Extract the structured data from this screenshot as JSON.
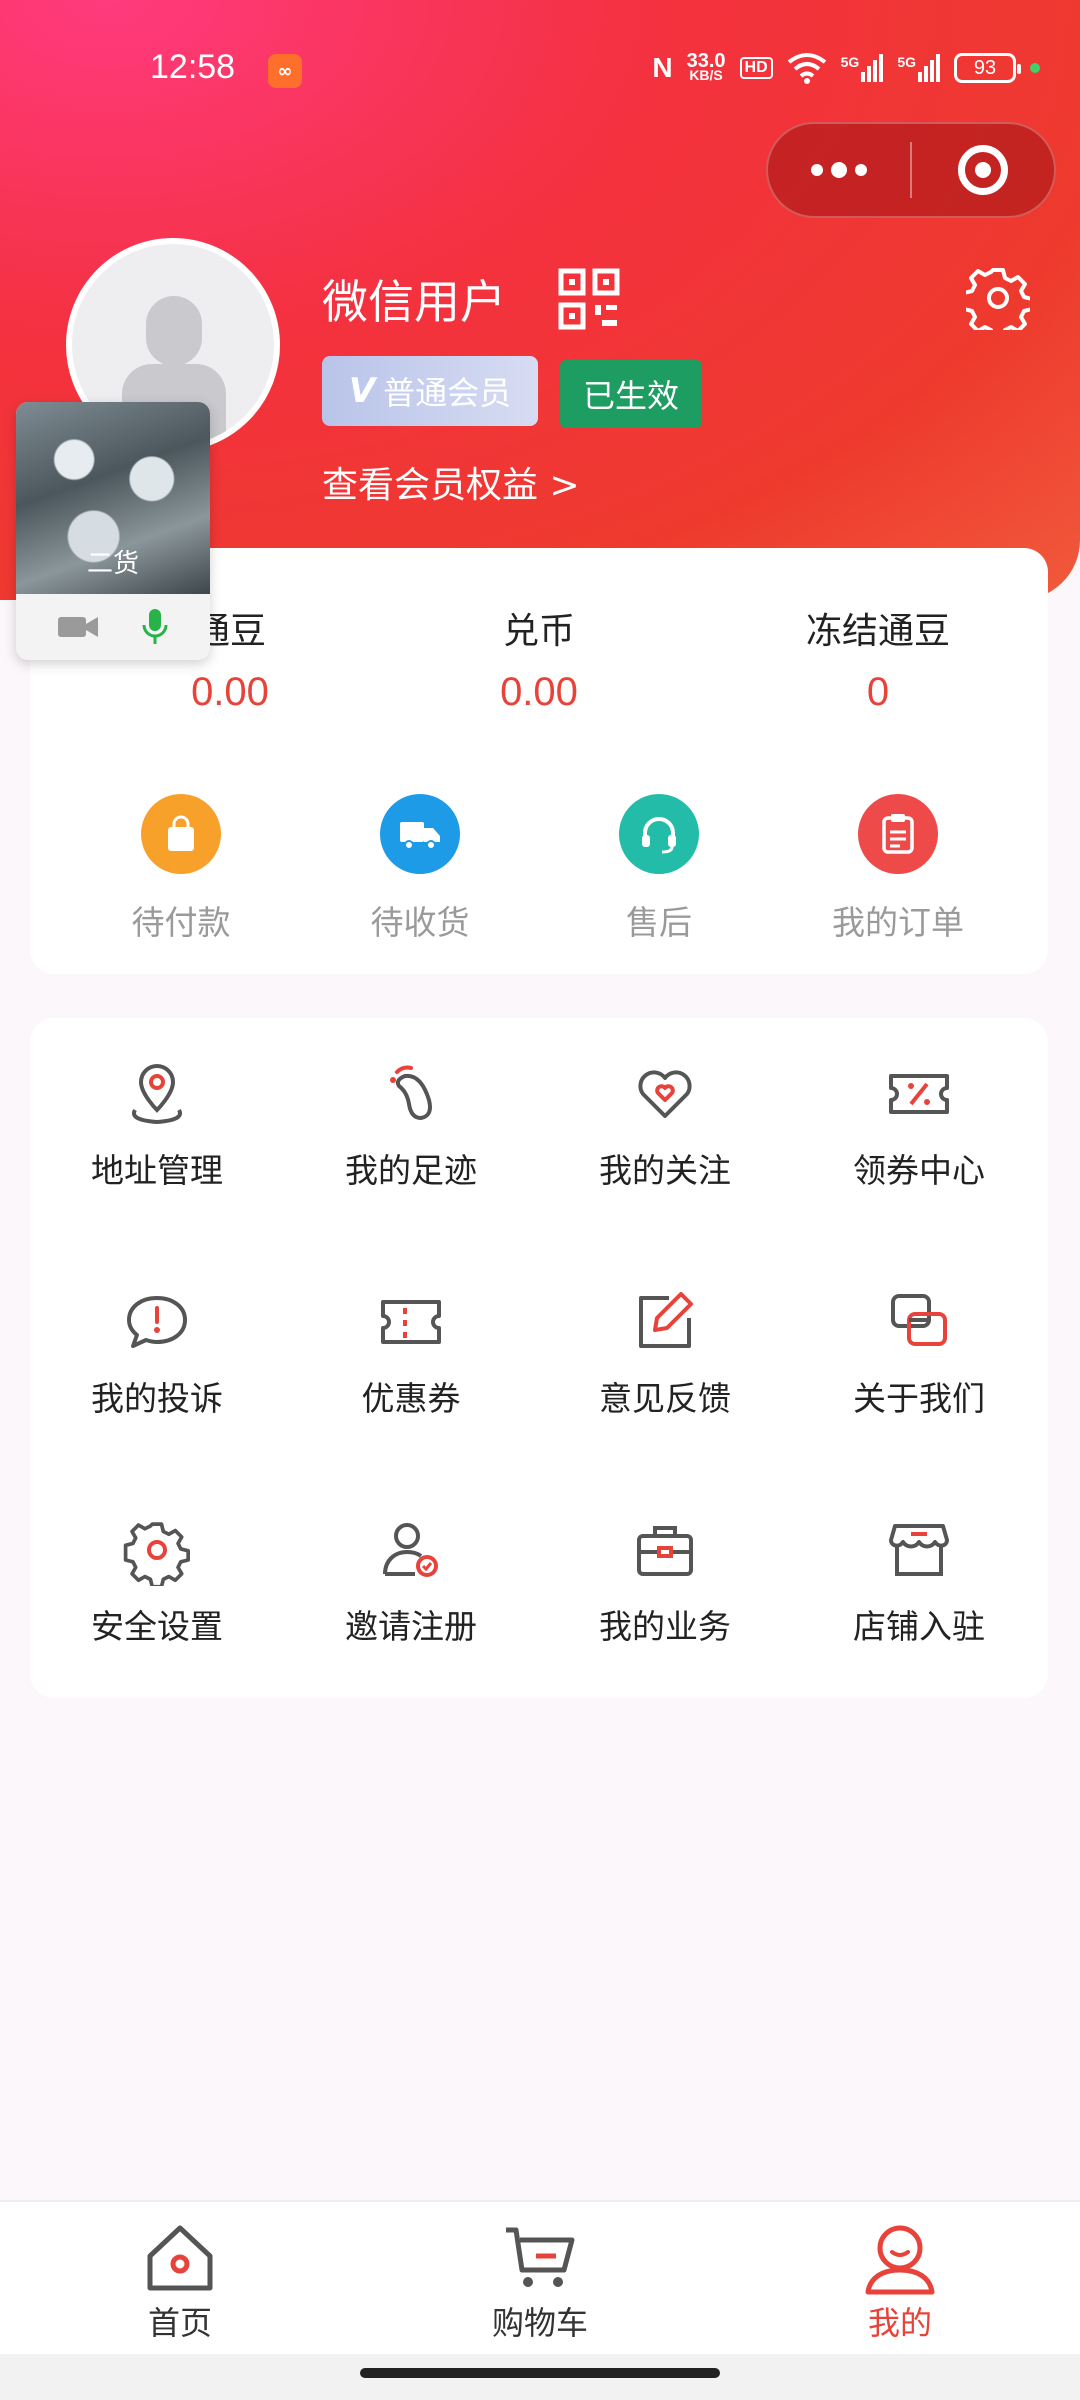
{
  "status_bar": {
    "time": "12:58",
    "speed_value": "33.0",
    "speed_unit": "KB/S",
    "hd": "HD",
    "net1": "5G",
    "net2": "5G",
    "battery": "93"
  },
  "profile": {
    "username": "微信用户",
    "vip_letter": "V",
    "vip_label": "普通会员",
    "status_badge": "已生效",
    "member_link": "查看会员权益 >"
  },
  "float_video": {
    "name": "二货"
  },
  "assets": [
    {
      "label": "通豆",
      "value": "0.00"
    },
    {
      "label": "兑币",
      "value": "0.00"
    },
    {
      "label": "冻结通豆",
      "value": "0"
    }
  ],
  "orders": [
    {
      "label": "待付款",
      "icon": "bag-icon",
      "color": "#f7a12b"
    },
    {
      "label": "待收货",
      "icon": "truck-icon",
      "color": "#1e9be6"
    },
    {
      "label": "售后",
      "icon": "headset-icon",
      "color": "#23bca8"
    },
    {
      "label": "我的订单",
      "icon": "clipboard-icon",
      "color": "#ef4a4a"
    }
  ],
  "menu": [
    {
      "label": "地址管理",
      "icon": "location-pin-icon"
    },
    {
      "label": "我的足迹",
      "icon": "footprint-icon"
    },
    {
      "label": "我的关注",
      "icon": "heart-icon"
    },
    {
      "label": "领券中心",
      "icon": "percent-ticket-icon"
    },
    {
      "label": "我的投诉",
      "icon": "complaint-bubble-icon"
    },
    {
      "label": "优惠券",
      "icon": "coupon-icon"
    },
    {
      "label": "意见反馈",
      "icon": "edit-icon"
    },
    {
      "label": "关于我们",
      "icon": "about-icon"
    },
    {
      "label": "安全设置",
      "icon": "gear-icon"
    },
    {
      "label": "邀请注册",
      "icon": "invite-user-icon"
    },
    {
      "label": "我的业务",
      "icon": "briefcase-icon"
    },
    {
      "label": "店铺入驻",
      "icon": "store-icon"
    }
  ],
  "tabbar": [
    {
      "label": "首页",
      "icon": "home-icon"
    },
    {
      "label": "购物车",
      "icon": "cart-icon"
    },
    {
      "label": "我的",
      "icon": "user-icon"
    }
  ],
  "colors": {
    "accent": "#e8433a",
    "header_gradient": [
      "#ff3a7e",
      "#ee3a2e"
    ],
    "active_badge": "#1e9d63"
  }
}
